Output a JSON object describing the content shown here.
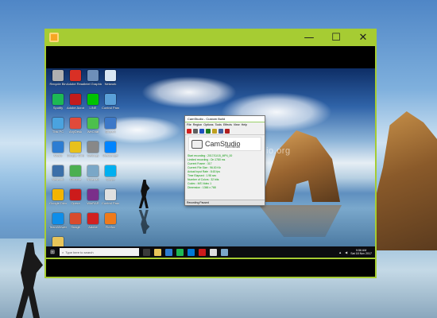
{
  "desktop": {
    "accent": "#a6cc33"
  },
  "window": {
    "min_glyph": "—",
    "max_glyph": "☐",
    "close_glyph": "✕"
  },
  "icons": [
    {
      "label": "Recycle Bin",
      "color": "#b0b0b0"
    },
    {
      "label": "Adobe Reader XI",
      "color": "#d93025"
    },
    {
      "label": "Intel Graphics",
      "color": "#6e8fb9"
    },
    {
      "label": "Network",
      "color": "#d9e6f2"
    },
    {
      "label": "Spotify",
      "color": "#1db954"
    },
    {
      "label": "Adobe Acrobat",
      "color": "#c31c1c"
    },
    {
      "label": "LINE",
      "color": "#00c300"
    },
    {
      "label": "Control Panel",
      "color": "#5aa0d8"
    },
    {
      "label": "This PC",
      "color": "#4aa3df"
    },
    {
      "label": "AnyDesk",
      "color": "#e04a3a"
    },
    {
      "label": "WeChat",
      "color": "#4cc04c"
    },
    {
      "label": "ShareX",
      "color": "#3c78c8"
    },
    {
      "label": "Music",
      "color": "#2d7dd2"
    },
    {
      "label": "Google Chrome",
      "color": "#e8c11b"
    },
    {
      "label": "Settings",
      "color": "#888888"
    },
    {
      "label": "Messenger",
      "color": "#0084ff"
    },
    {
      "label": "Network",
      "color": "#3c6fa8"
    },
    {
      "label": "Chrome",
      "color": "#4caf50"
    },
    {
      "label": "Notepad",
      "color": "#7aa7c7"
    },
    {
      "label": "Skype",
      "color": "#00aff0"
    },
    {
      "label": "Google Drive",
      "color": "#f4b400"
    },
    {
      "label": "Opera",
      "color": "#cc1b1b"
    },
    {
      "label": "WinRAR",
      "color": "#7a2f8a"
    },
    {
      "label": "Control Panel",
      "color": "#e0e0e0"
    },
    {
      "label": "TeamViewer",
      "color": "#0e8ee9"
    },
    {
      "label": "Snagit",
      "color": "#d84b2c"
    },
    {
      "label": "Adobe",
      "color": "#d12020"
    },
    {
      "label": "Firefox",
      "color": "#f07a1a"
    },
    {
      "label": "Folder",
      "color": "#e8c55a"
    }
  ],
  "camstudio": {
    "title": "CamStudio - Custom Build",
    "menu": [
      "File",
      "Region",
      "Options",
      "Tools",
      "Effects",
      "View",
      "Help"
    ],
    "logo_text": "CamStudio",
    "logo_sub": "RECORDER",
    "info": [
      "Start recording : 2017/11/15_MP4_00",
      "Limited recording : On 1780 ms",
      "Current Frame : 317",
      "Current File Size : 96.00 Kb",
      "Actual Input Rate : 8.63 fps",
      "Time Elapsed : 1.98 sec",
      "Number of Colors : 32 bits",
      "Codec : MS Video 1",
      "Dimension : 1366 x 768"
    ],
    "status": "Recording Paused",
    "watermark": "camstudio.org",
    "toolbar_colors": [
      "#d02020",
      "#606060",
      "#2050c0",
      "#208020",
      "#c0a020",
      "#4060a0",
      "#b02020"
    ]
  },
  "taskbar": {
    "search_placeholder": "Type here to search",
    "apps": [
      {
        "name": "task-view",
        "color": "#3a3a3a"
      },
      {
        "name": "file-explorer",
        "color": "#e8c55a"
      },
      {
        "name": "mail",
        "color": "#2d7dd2"
      },
      {
        "name": "spotify",
        "color": "#1db954"
      },
      {
        "name": "store",
        "color": "#0078d7"
      },
      {
        "name": "opera",
        "color": "#cc1b1b"
      },
      {
        "name": "camstudio",
        "color": "#dddddd"
      },
      {
        "name": "photos",
        "color": "#7aa7c7"
      }
    ],
    "time": "9:56 AM",
    "date": "Sat 18 Nov 2017"
  }
}
